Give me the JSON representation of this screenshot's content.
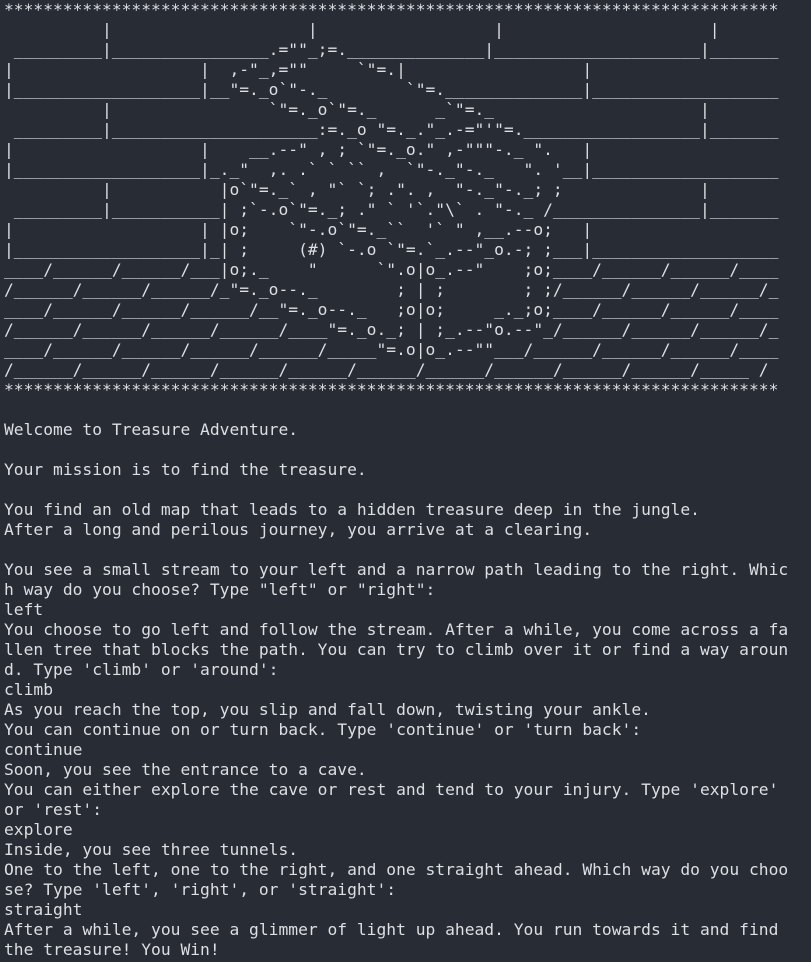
{
  "terminal": {
    "background": "#282c34",
    "foreground": "#dcdfe4",
    "banner_lines": [
      "*******************************************************************************",
      "          |                    |                  |                     |",
      " _________|________________.=\"\"_;=.______________|_____________________|_______",
      "|                   |  ,-\"_,=\"\"     `\"=.|                  |",
      "|___________________|__\"=._o`\"-._        `\"=.______________|___________________",
      "          |                `\"=._o`\"=._      _`\"=._                     |",
      " _________|_____________________:=._o \"=._.\"_.-=\"'\"=.__________________|_______",
      "|                   |    __.--\" , ; `\"=._o.\" ,-\"\"\"-._ \".   |",
      "|___________________|_._\"  ,. .` ` `` ,  `\"-._\"-._   \". '__|___________________",
      "          |           |o`\"=._` , \"` `; .\". ,  \"-._\"-._; ;              |",
      " _________|___________| ;`-.o`\"=._; .\" ` '`.\"\\` . \"-._ /_______________|_______",
      "|                   | |o;    `\"-.o`\"=._``  '` \" ,__.--o;   |",
      "|___________________|_| ;     (#) `-.o `\"=.`_.--\"_o.-; ;___|___________________",
      "____/______/______/___|o;._    \"      `\".o|o_.--\"    ;o;____/______/______/____",
      "/______/______/______/_\"=._o--._        ; | ;        ; ;/______/______/______/_",
      "____/______/______/______/__\"=._o--._   ;o|o;     _._;o;____/______/______/____",
      "/______/______/______/______/____\"=._o._; | ;_.--\"o.--\"_/______/______/______/_",
      "____/______/______/______/______/_____\"=.o|o_.--\"\"___/______/______/______/____",
      "/______/______/______/______/______/______/______/______/______/______/_____ /",
      "*******************************************************************************"
    ],
    "log_lines": [
      "",
      "Welcome to Treasure Adventure.",
      "",
      "Your mission is to find the treasure.",
      "",
      "You find an old map that leads to a hidden treasure deep in the jungle.",
      "After a long and perilous journey, you arrive at a clearing.",
      "",
      "You see a small stream to your left and a narrow path leading to the right. Whic",
      "h way do you choose? Type \"left\" or \"right\":",
      "left",
      "You choose to go left and follow the stream. After a while, you come across a fa",
      "llen tree that blocks the path. You can try to climb over it or find a way aroun",
      "d. Type 'climb' or 'around':",
      "climb",
      "As you reach the top, you slip and fall down, twisting your ankle.",
      "You can continue on or turn back. Type 'continue' or 'turn back':",
      "continue",
      "Soon, you see the entrance to a cave.",
      "You can either explore the cave or rest and tend to your injury. Type 'explore'",
      "or 'rest':",
      "explore",
      "Inside, you see three tunnels.",
      "One to the left, one to the right, and one straight ahead. Which way do you choo",
      "se? Type 'left', 'right', or 'straight':",
      "straight",
      "After a while, you see a glimmer of light up ahead. You run towards it and find",
      "the treasure! You Win!"
    ]
  }
}
